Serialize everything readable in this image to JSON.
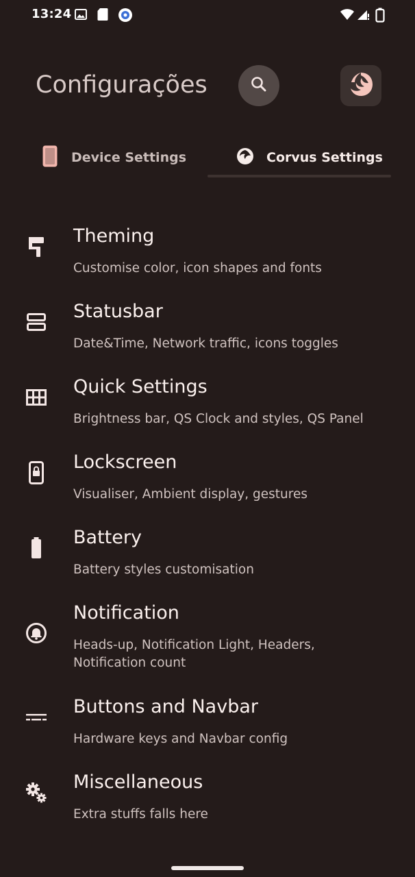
{
  "status_bar": {
    "time": "13:24",
    "left_icons": [
      "gallery-icon",
      "sd-card-icon",
      "settings-gear-notification-icon"
    ],
    "right_icons": [
      "wifi-icon",
      "cellular-signal-icon",
      "battery-icon"
    ]
  },
  "header": {
    "title": "Configurações",
    "search_icon": "search-icon",
    "app_icon": "corvus-logo-icon"
  },
  "tabs": [
    {
      "label": "Device Settings",
      "icon": "phone-icon",
      "selected": false
    },
    {
      "label": "Corvus Settings",
      "icon": "corvus-icon",
      "selected": true
    }
  ],
  "items": [
    {
      "title": "Theming",
      "subtitle": "Customise color, icon shapes and fonts",
      "icon": "paint-roller-icon"
    },
    {
      "title": "Statusbar",
      "subtitle": "Date&Time, Network traffic, icons toggles",
      "icon": "statusbar-icon"
    },
    {
      "title": "Quick Settings",
      "subtitle": "Brightness bar, QS Clock and styles, QS Panel",
      "icon": "grid-icon"
    },
    {
      "title": "Lockscreen",
      "subtitle": "Visualiser, Ambient display, gestures",
      "icon": "lock-screen-icon"
    },
    {
      "title": "Battery",
      "subtitle": "Battery styles customisation",
      "icon": "battery-icon"
    },
    {
      "title": "Notification",
      "subtitle": "Heads-up, Notification Light, Headers,",
      "subtitle2": "Notification count",
      "icon": "notification-bell-icon"
    },
    {
      "title": "Buttons and Navbar",
      "subtitle": "Hardware keys and Navbar config",
      "icon": "navbar-icon"
    },
    {
      "title": "Miscellaneous",
      "subtitle": "Extra stuffs falls here",
      "icon": "gears-icon"
    }
  ],
  "colors": {
    "background": "#241b1a",
    "accent_pink": "#f2c0b8",
    "text_primary": "#fbf1ee",
    "text_secondary": "#d0c3c0"
  }
}
